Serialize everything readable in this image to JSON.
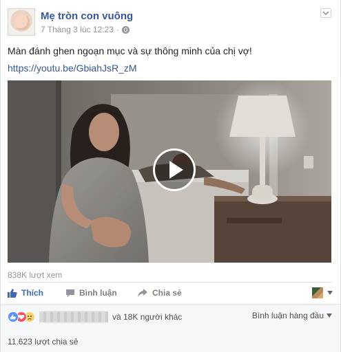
{
  "post": {
    "page_name": "Mẹ tròn con vuông",
    "timestamp": "7 Tháng 3 lúc 12:23",
    "separator": "·",
    "privacy_icon": "globe-icon",
    "text": "Màn đánh ghen ngoạn mục và sự thông minh của chị vợ!",
    "link": "https://youtu.be/GbiahJsR_zM"
  },
  "video": {
    "views": "838K lượt xem"
  },
  "actions": {
    "like_label": "Thích",
    "comment_label": "Bình luận",
    "share_label": "Chia sẻ"
  },
  "reactions": {
    "icons": [
      "like-icon",
      "love-icon",
      "sad-icon"
    ],
    "others_text": "và 18K người khác",
    "sort_label": "Bình luận hàng đầu",
    "shares_text": "11.623 lượt chia sẻ"
  },
  "colors": {
    "link": "#365899",
    "accent": "#4267b2",
    "muted": "#90949c"
  }
}
